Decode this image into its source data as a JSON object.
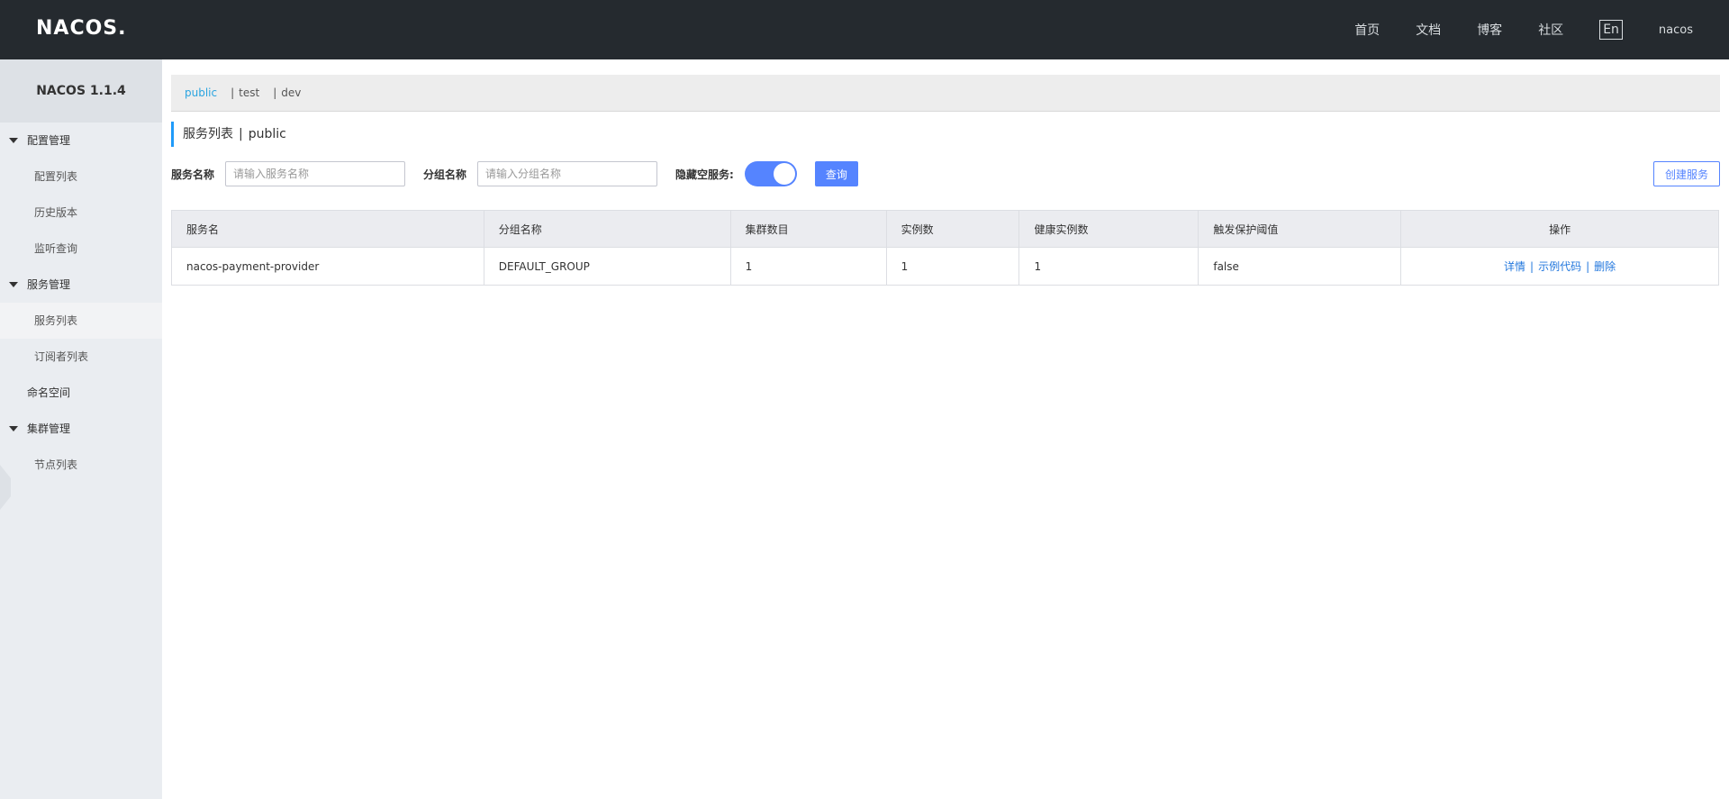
{
  "header": {
    "logo": "NACOS.",
    "nav": [
      "首页",
      "文档",
      "博客",
      "社区"
    ],
    "lang": "En",
    "user": "nacos"
  },
  "sidebar": {
    "title": "NACOS 1.1.4",
    "groups": [
      {
        "label": "配置管理",
        "items": [
          "配置列表",
          "历史版本",
          "监听查询"
        ]
      },
      {
        "label": "服务管理",
        "items": [
          "服务列表",
          "订阅者列表"
        ]
      },
      {
        "label": "命名空间"
      },
      {
        "label": "集群管理",
        "items": [
          "节点列表"
        ]
      }
    ]
  },
  "namespaces": {
    "items": [
      "public",
      "test",
      "dev"
    ],
    "active": "public",
    "separator": "|"
  },
  "page": {
    "title": "服务列表",
    "pipe": "|",
    "namespace": "public"
  },
  "filters": {
    "service_name_label": "服务名称",
    "service_name_placeholder": "请输入服务名称",
    "group_name_label": "分组名称",
    "group_name_placeholder": "请输入分组名称",
    "hide_empty_label": "隐藏空服务:",
    "hide_empty_on": true,
    "query_button": "查询",
    "create_button": "创建服务"
  },
  "table": {
    "columns": [
      "服务名",
      "分组名称",
      "集群数目",
      "实例数",
      "健康实例数",
      "触发保护阈值",
      "操作"
    ],
    "rows": [
      {
        "service": "nacos-payment-provider",
        "group": "DEFAULT_GROUP",
        "clusters": "1",
        "instances": "1",
        "healthy": "1",
        "threshold": "false",
        "actions": [
          "详情",
          "示例代码",
          "删除"
        ]
      }
    ],
    "action_separator": "|"
  }
}
